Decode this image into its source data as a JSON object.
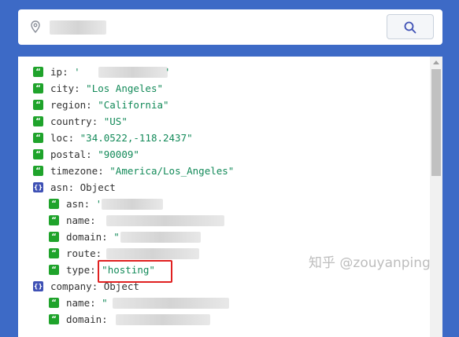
{
  "search": {
    "placeholder": "",
    "value": "",
    "button_icon": "search-icon",
    "field_icon": "location-pin-icon"
  },
  "rows": [
    {
      "kind": "string",
      "key": "ip",
      "value": "'",
      "redacted": true
    },
    {
      "kind": "string",
      "key": "city",
      "value": "\"Los Angeles\""
    },
    {
      "kind": "string",
      "key": "region",
      "value": "\"California\""
    },
    {
      "kind": "string",
      "key": "country",
      "value": "\"US\""
    },
    {
      "kind": "string",
      "key": "loc",
      "value": "\"34.0522,-118.2437\""
    },
    {
      "kind": "string",
      "key": "postal",
      "value": "\"90009\""
    },
    {
      "kind": "string",
      "key": "timezone",
      "value": "\"America/Los_Angeles\""
    },
    {
      "kind": "object",
      "key": "asn",
      "label": "Object"
    },
    {
      "kind": "string",
      "key": "asn",
      "value": "'",
      "redacted": true,
      "indent": 1
    },
    {
      "kind": "string",
      "key": "name",
      "value": "",
      "redacted": true,
      "indent": 1
    },
    {
      "kind": "string",
      "key": "domain",
      "value": "\"",
      "redacted": true,
      "indent": 1
    },
    {
      "kind": "string",
      "key": "route",
      "value": "",
      "redacted": true,
      "indent": 1
    },
    {
      "kind": "string",
      "key": "type",
      "value": "\"hosting\"",
      "indent": 1,
      "highlighted": true
    },
    {
      "kind": "object",
      "key": "company",
      "label": "Object"
    },
    {
      "kind": "string",
      "key": "name",
      "value": "\"",
      "redacted": true,
      "indent": 1
    },
    {
      "kind": "string",
      "key": "domain",
      "value": "",
      "redacted": true,
      "indent": 1
    }
  ],
  "watermark": "知乎 @zouyanping",
  "colors": {
    "background": "#3d6ac6",
    "string_badge": "#1fa32b",
    "object_badge": "#3f51b5",
    "value_text": "#138a59",
    "highlight_border": "#e02020"
  }
}
